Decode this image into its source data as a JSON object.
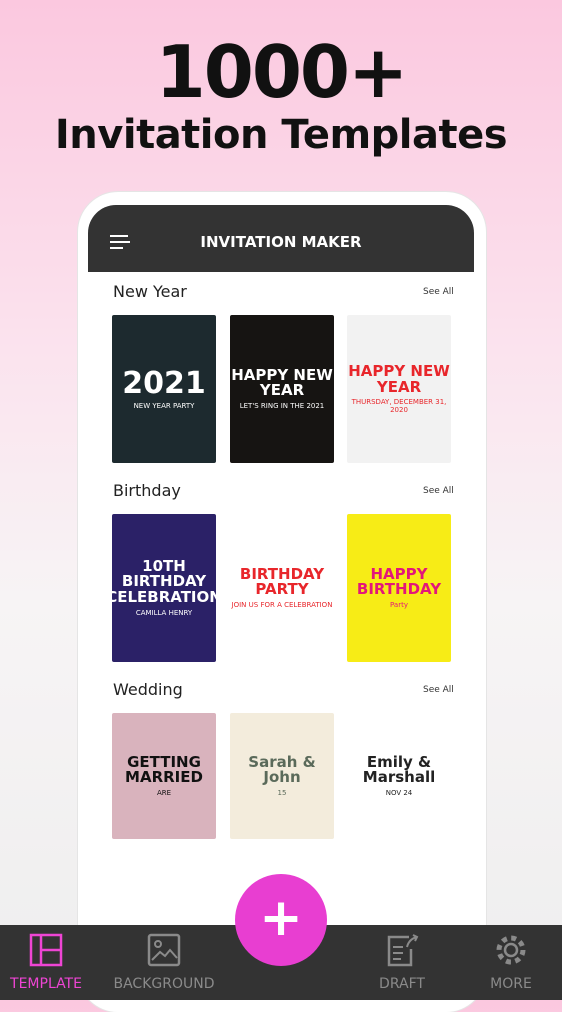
{
  "promo": {
    "line1": "1000+",
    "line2": "Invitation Templates"
  },
  "appbar": {
    "title": "INVITATION MAKER",
    "menu_icon": "hamburger-icon"
  },
  "sections": [
    {
      "title": "New Year",
      "see_all": "See All",
      "cards": [
        {
          "headline": "2021",
          "sub": "NEW YEAR PARTY",
          "bg": "#1d2a2f",
          "fg": "#ffffff"
        },
        {
          "headline": "HAPPY NEW YEAR",
          "sub": "LET'S RING IN THE 2021",
          "bg": "#161412",
          "fg": "#ffffff"
        },
        {
          "headline": "HAPPY NEW YEAR",
          "sub": "THURSDAY, DECEMBER 31, 2020",
          "bg": "#f2f2f2",
          "fg": "#e8262b"
        }
      ]
    },
    {
      "title": "Birthday",
      "see_all": "See All",
      "cards": [
        {
          "headline": "10TH BIRTHDAY CELEBRATION",
          "sub": "CAMILLA HENRY",
          "bg": "#2b2167",
          "fg": "#ffffff"
        },
        {
          "headline": "BIRTHDAY PARTY",
          "sub": "JOIN US FOR A CELEBRATION",
          "bg": "#ffffff",
          "fg": "#e8262b"
        },
        {
          "headline": "HAPPY BIRTHDAY",
          "sub": "Party",
          "bg": "#f7ec16",
          "fg": "#e3177a"
        }
      ]
    },
    {
      "title": "Wedding",
      "see_all": "See All",
      "cards": [
        {
          "headline": "GETTING MARRIED",
          "sub": "ARE",
          "bg": "#d9b3bd",
          "fg": "#111111"
        },
        {
          "headline": "Sarah & John",
          "sub": "15",
          "bg": "#f3ecdc",
          "fg": "#5a6a5a"
        },
        {
          "headline": "Emily & Marshall",
          "sub": "NOV 24",
          "bg": "#ffffff",
          "fg": "#222222"
        }
      ]
    }
  ],
  "nav": {
    "items": [
      {
        "label": "TEMPLATE",
        "icon": "template-layout-icon",
        "active": true
      },
      {
        "label": "BACKGROUND",
        "icon": "image-icon"
      },
      {
        "label": "DRAFT",
        "icon": "draft-edit-icon"
      },
      {
        "label": "MORE",
        "icon": "gear-icon"
      }
    ],
    "fab_label": "+",
    "active_color": "#ee45d4"
  }
}
